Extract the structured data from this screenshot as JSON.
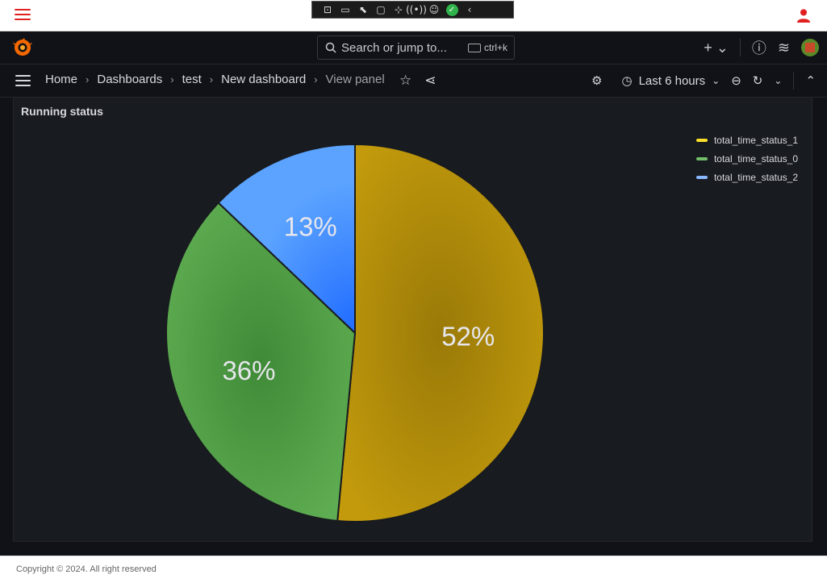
{
  "search": {
    "placeholder": "Search or jump to...",
    "shortcut": "ctrl+k"
  },
  "breadcrumb": {
    "items": [
      "Home",
      "Dashboards",
      "test",
      "New dashboard",
      "View panel"
    ],
    "separator": "›"
  },
  "time_range": {
    "label": "Last 6 hours"
  },
  "panel": {
    "title": "Running status"
  },
  "chart_data": {
    "type": "pie",
    "title": "Running status",
    "series": [
      {
        "name": "total_time_status_1",
        "value": 52,
        "label": "52%",
        "color": "#b8920b"
      },
      {
        "name": "total_time_status_0",
        "value": 36,
        "label": "36%",
        "color": "#56a64b"
      },
      {
        "name": "total_time_status_2",
        "value": 13,
        "label": "13%",
        "color": "#3d8bff"
      }
    ],
    "legend_position": "top-right"
  },
  "footer": {
    "text": "Copyright © 2024. All right reserved"
  },
  "colors": {
    "accent_red": "#e02020",
    "background": "#111217",
    "panel": "#181b1f"
  }
}
